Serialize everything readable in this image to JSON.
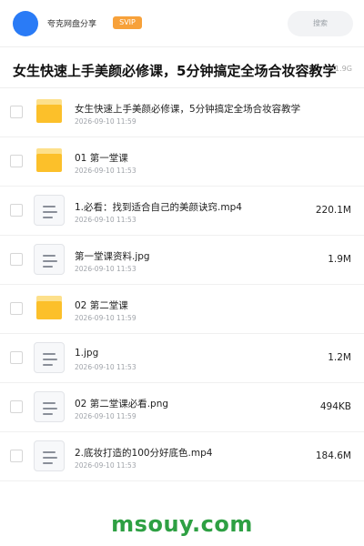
{
  "header": {
    "share_name": "夸克网盘分享",
    "badge": "SVIP",
    "search_label": "搜索"
  },
  "folder": {
    "title": "女生快速上手美颜必修课，5分钟搞定全场合妆容教学",
    "total_size": "1.9G"
  },
  "items": [
    {
      "type": "folder",
      "name": "女生快速上手美颜必修课，5分钟搞定全场合妆容教学",
      "date": "2026-09-10 11:59",
      "size": ""
    },
    {
      "type": "folder",
      "name": "01 第一堂课",
      "date": "2026-09-10 11:53",
      "size": ""
    },
    {
      "type": "file",
      "name": "1.必看：找到适合自己的美颜诀窍.mp4",
      "date": "2026-09-10 11:53",
      "size": "220.1M"
    },
    {
      "type": "file",
      "name": "第一堂课资料.jpg",
      "date": "2026-09-10 11:53",
      "size": "1.9M"
    },
    {
      "type": "folder",
      "name": "02 第二堂课",
      "date": "2026-09-10 11:59",
      "size": ""
    },
    {
      "type": "file",
      "name": "1.jpg",
      "date": "2026-09-10 11:53",
      "size": "1.2M"
    },
    {
      "type": "file",
      "name": "02 第二堂课必看.png",
      "date": "2026-09-10 11:59",
      "size": "494KB"
    },
    {
      "type": "file",
      "name": "2.底妆打造的100分好底色.mp4",
      "date": "2026-09-10 11:53",
      "size": "184.6M"
    }
  ],
  "watermark": "msouy.com",
  "colors": {
    "avatar": "#2a7bf6",
    "badge": "#f7a13a",
    "folder": "#fcc02a",
    "watermark": "#2ea043"
  },
  "icons": {
    "folder": "folder-icon",
    "file": "file-icon"
  }
}
